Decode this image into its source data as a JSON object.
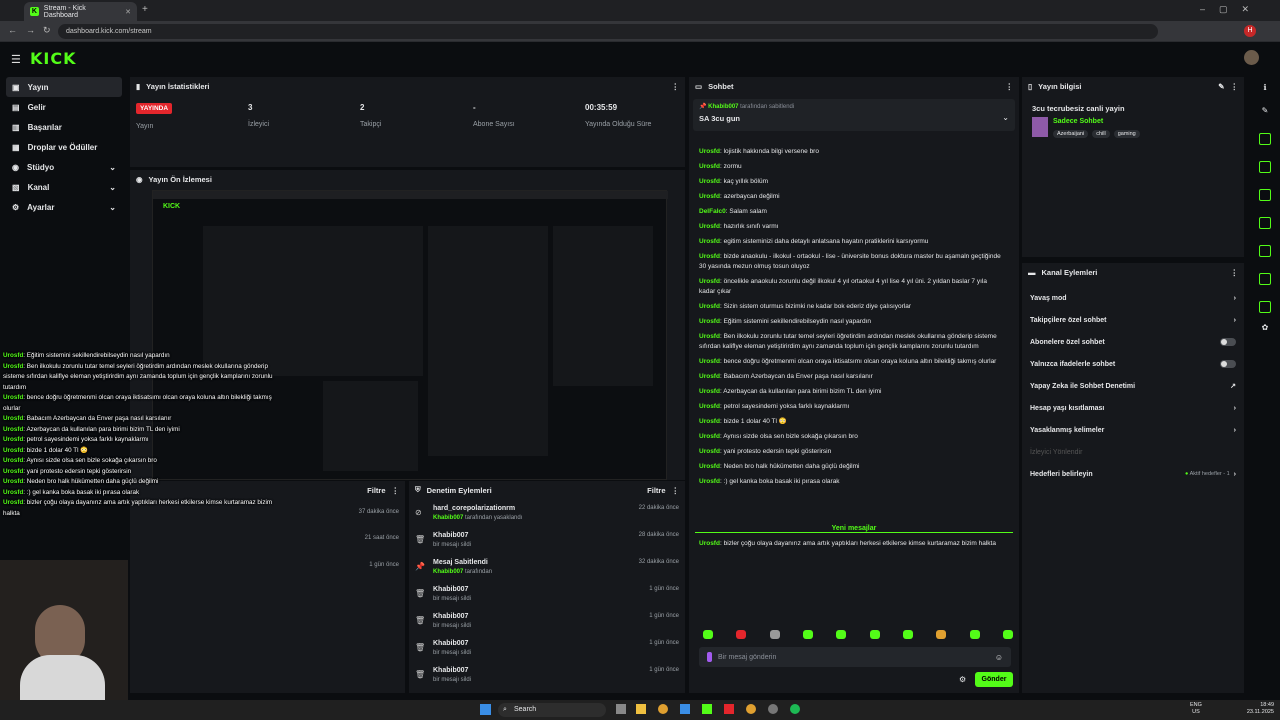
{
  "browser": {
    "tab_title": "Stream - Kick Dashboard",
    "url": "dashboard.kick.com/stream"
  },
  "brand": {
    "logo": "KICK",
    "accent": "#53fc18"
  },
  "sidebar": {
    "items": [
      {
        "label": "Yayın"
      },
      {
        "label": "Gelir"
      },
      {
        "label": "Başarılar"
      },
      {
        "label": "Droplar ve Ödüller"
      },
      {
        "label": "Stüdyo"
      },
      {
        "label": "Kanal"
      },
      {
        "label": "Ayarlar"
      }
    ]
  },
  "stats": {
    "title": "Yayın İstatistikleri",
    "live_badge": "YAYINDA",
    "live_label": "Yayın",
    "viewers_value": "3",
    "viewers_label": "İzleyici",
    "followers_value": "2",
    "followers_label": "Takipçi",
    "subs_value": "-",
    "subs_label": "Abone Sayısı",
    "uptime_value": "00:35:59",
    "uptime_label": "Yayında Olduğu Süre"
  },
  "preview": {
    "title": "Yayın Ön İzlemesi"
  },
  "overlay_chat": [
    {
      "user": "Urosfd",
      "text": ": Eğitim sistemini sekillendirebilseydin nasıl yapardın"
    },
    {
      "user": "Urosfd",
      "text": ": Ben ilkokulu zorunlu tutar temel seyleri öğretirdim ardından meslek okullarına gönderip sisteme sıfırdan kaliflye eleman yetiştirirdim aynı zamanda toplum için gençlik kamplarını zorunlu tutardım"
    },
    {
      "user": "Urosfd",
      "text": ": bence doğru öğretmenmi olcan oraya iktisatsımı olcan oraya koluna altın bilekliği takmış olurlar"
    },
    {
      "user": "Urosfd",
      "text": ": Babacım Azerbaycan da Enver paşa nasıl karsılanır"
    },
    {
      "user": "Urosfd",
      "text": ": Azerbaycan da kullanılan para birimi bizim TL den iyimi"
    },
    {
      "user": "Urosfd",
      "text": ": petrol sayesindemi yoksa farklı kaynaklarmı"
    },
    {
      "user": "Urosfd",
      "text": ": bizde 1 dolar 40 Tl 😳"
    },
    {
      "user": "Urosfd",
      "text": ": Aynısı sizde olsa sen bizle sokağa çıkarsın bro"
    },
    {
      "user": "Urosfd",
      "text": ": yani protesto edersin tepki gösterirsin"
    },
    {
      "user": "Urosfd",
      "text": ": Neden bro halk hükümetten daha güçlü değilmi"
    },
    {
      "user": "Urosfd",
      "text": ": :) gel kanka boka basak iki pırasa olarak"
    },
    {
      "user": "Urosfd",
      "text": ": bizler çoğu olaya dayanırız ama artık yaptıkları herkesi etkilerse kimse kurtaramaz bizim halkta"
    }
  ],
  "activity": {
    "filter": "Filtre",
    "times": [
      "37 dakika önce",
      "21 saat önce",
      "1 gün önce"
    ]
  },
  "moderation": {
    "title": "Denetim Eylemleri",
    "filter": "Filtre",
    "rows": [
      {
        "name": "hard_corepolarizationrm",
        "sub_user": "Khabib007",
        "sub": "tarafından yasaklandı",
        "time": "22 dakika önce"
      },
      {
        "name": "Khabib007",
        "sub_user": "",
        "sub": "bir mesajı sildi",
        "time": "28 dakika önce"
      },
      {
        "name": "Mesaj Sabitlendi",
        "sub_user": "Khabib007",
        "sub": "tarafından",
        "time": "32 dakika önce"
      },
      {
        "name": "Khabib007",
        "sub_user": "",
        "sub": "bir mesajı sildi",
        "time": "1 gün önce"
      },
      {
        "name": "Khabib007",
        "sub_user": "",
        "sub": "bir mesajı sildi",
        "time": "1 gün önce"
      },
      {
        "name": "Khabib007",
        "sub_user": "",
        "sub": "bir mesajı sildi",
        "time": "1 gün önce"
      },
      {
        "name": "Khabib007",
        "sub_user": "",
        "sub": "bir mesajı sildi",
        "time": "1 gün önce"
      }
    ]
  },
  "chat": {
    "title": "Sohbet",
    "pinned_user": "Khabib007",
    "pinned_by": "tarafından sabitlendi",
    "pinned_text": "SA 3cu gun",
    "messages": [
      {
        "user": "Urosfd",
        "text": "lojistik hakkında bilgi versene bro"
      },
      {
        "user": "Urosfd",
        "text": "zormu"
      },
      {
        "user": "Urosfd",
        "text": "kaç yıllık bölüm"
      },
      {
        "user": "Urosfd",
        "text": "azerbaycan değilmi"
      },
      {
        "user": "DelFalc0",
        "text": "Salam salam"
      },
      {
        "user": "Urosfd",
        "text": "hazırlık sınıfı varmı"
      },
      {
        "user": "Urosfd",
        "text": "egitim sisteminizi daha detaylı anlatsana hayatın pratiklerini karsıyormu"
      },
      {
        "user": "Urosfd",
        "text": "bizde anaokulu - ilkokul - ortaokul - lise - üniversite bonus doktura master bu aşamaln geçtiğinde 30 yasında mezun olmuş tosun oluyoz"
      },
      {
        "user": "Urosfd",
        "text": "öncelikle anaokulu zorunlu değil ilkokul 4 yıl ortaokul 4 yıl lise 4 yıl üni. 2 yıldan baslar 7 yıla kadar çıkar"
      },
      {
        "user": "Urosfd",
        "text": "Sizin sistem oturmus bizimki ne kadar bok ederiz diye çalısıyorlar"
      },
      {
        "user": "Urosfd",
        "text": "Eğitim sistemini sekillendirebilseydin nasıl yapardın"
      },
      {
        "user": "Urosfd",
        "text": "Ben ilkokulu zorunlu tutar temel seyleri öğretirdim ardından meslek okullarına gönderip sisteme sıfırdan kaliflye eleman yetiştirirdim aynı zamanda toplum için gençlik kamplarını zorunlu tutardım"
      },
      {
        "user": "Urosfd",
        "text": "bence doğru öğretmenmi olcan oraya iktisatsımı olcan oraya koluna altın bilekliği takmış olurlar"
      },
      {
        "user": "Urosfd",
        "text": "Babacım Azerbaycan da Enver paşa nasıl karsılanır"
      },
      {
        "user": "Urosfd",
        "text": "Azerbaycan da kullanılan para birimi bizim TL den iyimi"
      },
      {
        "user": "Urosfd",
        "text": "petrol sayesindemi yoksa farklı kaynaklarmı"
      },
      {
        "user": "Urosfd",
        "text": "bizde 1 dolar 40 Tl 😳"
      },
      {
        "user": "Urosfd",
        "text": "Aynısı sizde olsa sen bizle sokağa çıkarsın bro"
      },
      {
        "user": "Urosfd",
        "text": "yani protesto edersin tepki gösterirsin"
      },
      {
        "user": "Urosfd",
        "text": "Neden bro halk hükümetten daha güçlü değilmi"
      },
      {
        "user": "Urosfd",
        "text": ":) gel kanka boka basak iki pırasa olarak"
      }
    ],
    "new_messages": "Yeni mesajlar",
    "last_message": {
      "user": "Urosfd",
      "text": "bizler çoğu olaya dayanırız ama artık yaptıkları herkesi etkilerse kimse kurtaramaz bizim halkta"
    },
    "input_placeholder": "Bir mesaj gönderin",
    "send": "Gönder"
  },
  "stream_info": {
    "title": "Yayın bilgisi",
    "stream_title": "3cu tecrubesiz canli yayin",
    "category": "Sadece Sohbet",
    "tags": [
      "Azerbaijani",
      "chill",
      "gaming"
    ]
  },
  "channel_actions": {
    "title": "Kanal Eylemleri",
    "items": [
      {
        "label": "Yavaş mod",
        "type": "arrow"
      },
      {
        "label": "Takipçilere özel sohbet",
        "type": "arrow"
      },
      {
        "label": "Abonelere özel sohbet",
        "type": "toggle"
      },
      {
        "label": "Yalnızca ifadelerle sohbet",
        "type": "toggle"
      },
      {
        "label": "Yapay Zeka ile Sohbet Denetimi",
        "type": "link"
      },
      {
        "label": "Hesap yaşı kısıtlaması",
        "type": "arrow"
      },
      {
        "label": "Yasaklanmış kelimeler",
        "type": "arrow"
      }
    ],
    "disabled_label": "İzleyici Yönlendir",
    "goals_label": "Hedefleri belirleyin",
    "goals_status": "Aktif hedefler - 1"
  },
  "taskbar": {
    "search": "Search",
    "lang": "ENG",
    "region": "US",
    "time": "18:49",
    "date": "23.11.2025"
  }
}
